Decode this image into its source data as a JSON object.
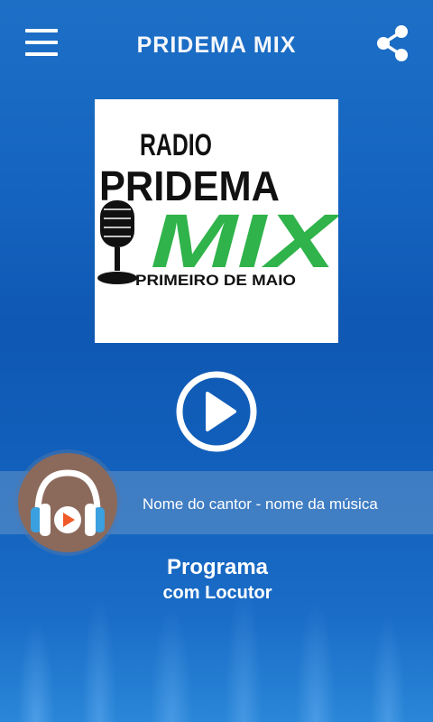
{
  "app": {
    "title": "PRIDEMA MIX"
  },
  "logo": {
    "line1": "RADIO",
    "line2": "PRIDEMA",
    "line3": "MIX",
    "line4": "PRIMEIRO DE MAIO"
  },
  "player": {
    "track": "Nome do cantor - nome da música",
    "state": "paused"
  },
  "program": {
    "name": "Programa",
    "host": "com Locutor"
  },
  "colors": {
    "logo_green": "#2fb34a",
    "avatar_bg": "#8b6a5c",
    "accent_orange": "#f05a28",
    "headphone_blue": "#3aa0e0"
  }
}
